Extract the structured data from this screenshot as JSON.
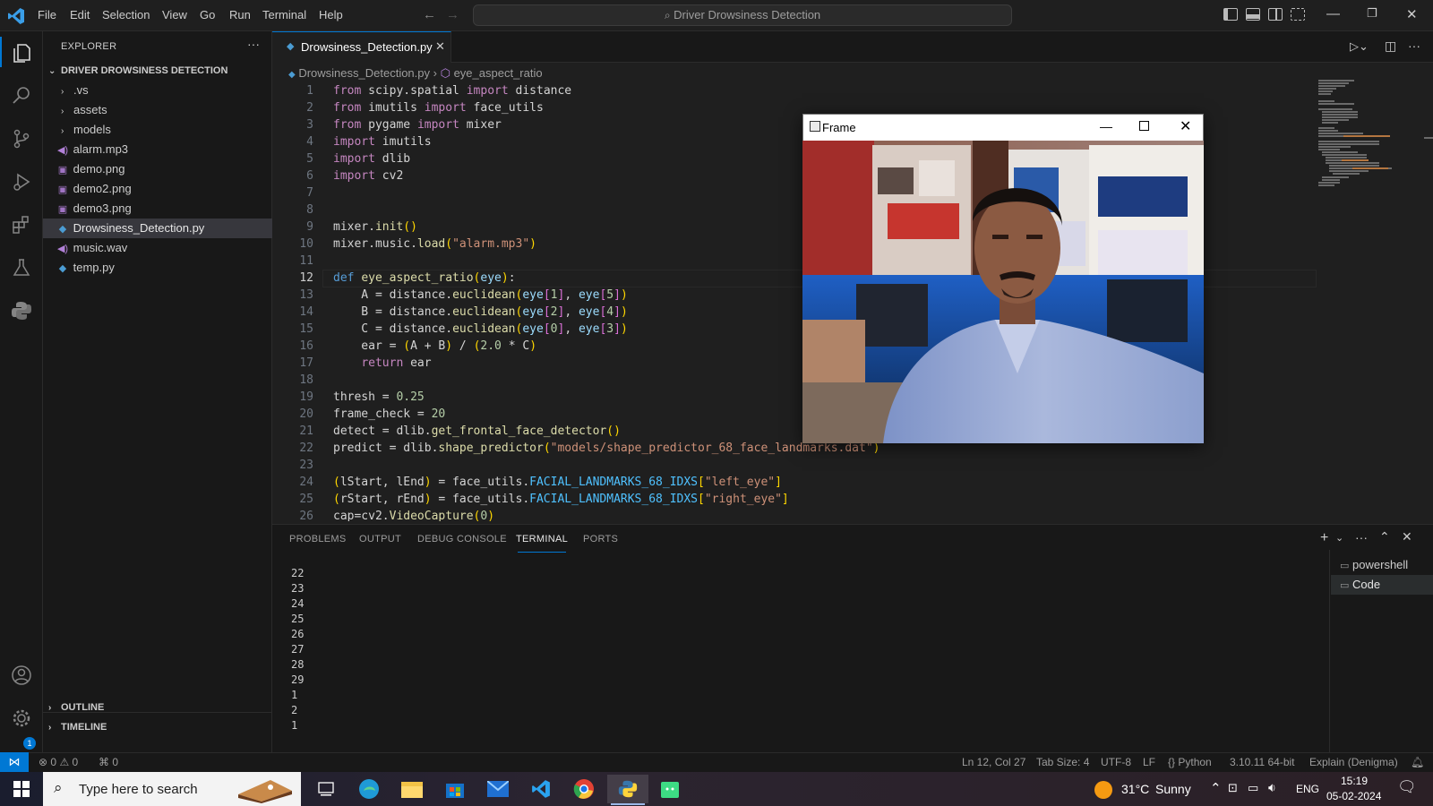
{
  "menu": [
    "File",
    "Edit",
    "Selection",
    "View",
    "Go",
    "Run",
    "Terminal",
    "Help"
  ],
  "command_center": "Driver Drowsiness Detection",
  "explorer": {
    "title": "EXPLORER",
    "folder": "DRIVER DROWSINESS DETECTION",
    "items": [
      {
        "label": ".vs",
        "kind": "folder"
      },
      {
        "label": "assets",
        "kind": "folder"
      },
      {
        "label": "models",
        "kind": "folder"
      },
      {
        "label": "alarm.mp3",
        "kind": "audio"
      },
      {
        "label": "demo.png",
        "kind": "image"
      },
      {
        "label": "demo2.png",
        "kind": "image"
      },
      {
        "label": "demo3.png",
        "kind": "image"
      },
      {
        "label": "Drowsiness_Detection.py",
        "kind": "python"
      },
      {
        "label": "music.wav",
        "kind": "audio"
      },
      {
        "label": "temp.py",
        "kind": "python"
      }
    ],
    "outline": "OUTLINE",
    "timeline": "TIMELINE"
  },
  "tab": {
    "label": "Drowsiness_Detection.py"
  },
  "breadcrumb": {
    "file": "Drowsiness_Detection.py",
    "symbol": "eye_aspect_ratio"
  },
  "code_numbers": [
    "1",
    "2",
    "3",
    "4",
    "5",
    "6",
    "7",
    "8",
    "9",
    "10",
    "11",
    "12",
    "13",
    "14",
    "15",
    "16",
    "17",
    "18",
    "19",
    "20",
    "21",
    "22",
    "23",
    "24",
    "25",
    "26"
  ],
  "panel": {
    "tabs": [
      "PROBLEMS",
      "OUTPUT",
      "DEBUG CONSOLE",
      "TERMINAL",
      "PORTS"
    ],
    "terminal_lines": [
      "22",
      "23",
      "24",
      "25",
      "26",
      "27",
      "28",
      "29",
      "1",
      "2",
      "1"
    ],
    "terminals": [
      "powershell",
      "Code"
    ]
  },
  "frame_window": {
    "title": "Frame"
  },
  "status": {
    "errors": "0",
    "warnings": "0",
    "ports": "0",
    "position": "Ln 12, Col 27",
    "tab_size": "Tab Size: 4",
    "encoding": "UTF-8",
    "eol": "LF",
    "language": "Python",
    "interpreter": "3.10.11 64-bit",
    "explain": "Explain (Denigma)",
    "settings_badge": "1"
  },
  "taskbar": {
    "search_placeholder": "Type here to search",
    "weather_temp": "31°C",
    "weather_desc": "Sunny",
    "lang": "ENG",
    "time": "15:19",
    "date": "05-02-2024"
  },
  "colors": {
    "accent": "#0078d4",
    "editor_bg": "#1f1f1f",
    "sidebar_bg": "#181818"
  }
}
